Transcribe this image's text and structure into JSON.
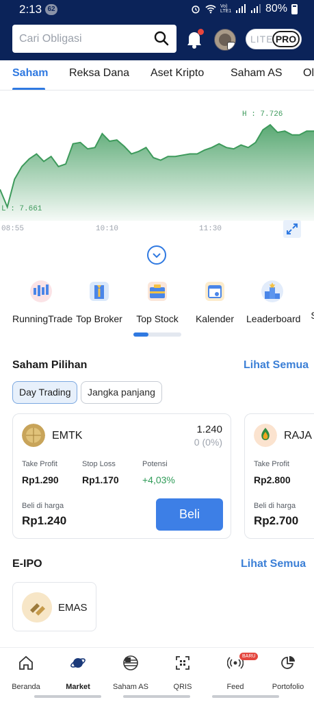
{
  "status_bar": {
    "time": "2:13",
    "notif_count": "62",
    "net_label": "Vo) LTE1",
    "battery": "80%"
  },
  "header": {
    "search_placeholder": "Cari Obligasi",
    "mode_lite": "LITE",
    "mode_pro": "PRO"
  },
  "tabs": [
    {
      "label": "Saham",
      "active": true
    },
    {
      "label": "Reksa Dana"
    },
    {
      "label": "Aset Kripto"
    },
    {
      "label": "Saham AS"
    },
    {
      "label": "Ol"
    }
  ],
  "chart_data": {
    "type": "area",
    "high_label": "H : 7.726",
    "low_label": "L : 7.661",
    "x_ticks": [
      "08:55",
      "10:10",
      "11:30"
    ],
    "color": "#3d9a5b",
    "high": 7.726,
    "low": 7.661,
    "y": [
      7.675,
      7.661,
      7.683,
      7.693,
      7.699,
      7.703,
      7.697,
      7.701,
      7.693,
      7.695,
      7.711,
      7.712,
      7.707,
      7.708,
      7.719,
      7.713,
      7.714,
      7.709,
      7.703,
      7.705,
      7.708,
      7.7,
      7.698,
      7.701,
      7.701,
      7.702,
      7.703,
      7.703,
      7.706,
      7.708,
      7.711,
      7.708,
      7.707,
      7.71,
      7.708,
      7.712,
      7.722,
      7.726,
      7.72,
      7.721,
      7.718,
      7.718,
      7.721,
      7.721
    ]
  },
  "shortcuts": [
    {
      "label": "RunningTrade",
      "icon": "running-trade-icon"
    },
    {
      "label": "Top Broker",
      "icon": "top-broker-icon"
    },
    {
      "label": "Top Stock",
      "icon": "top-stock-icon"
    },
    {
      "label": "Kalender",
      "icon": "calendar-icon"
    },
    {
      "label": "Leaderboard",
      "icon": "leaderboard-icon"
    },
    {
      "label": "S"
    }
  ],
  "saham_pilihan": {
    "title": "Saham Pilihan",
    "link": "Lihat Semua",
    "filters": [
      {
        "label": "Day Trading",
        "active": true
      },
      {
        "label": "Jangka panjang"
      }
    ],
    "cards": [
      {
        "code": "EMTK",
        "price": "1.240",
        "change": "0 (0%)",
        "take_profit_label": "Take Profit",
        "take_profit": "Rp1.290",
        "stop_loss_label": "Stop Loss",
        "stop_loss": "Rp1.170",
        "potensi_label": "Potensi",
        "potensi": "+4,03%",
        "beli_label": "Beli di harga",
        "beli_price": "Rp1.240",
        "buy_button": "Beli"
      },
      {
        "code": "RAJA",
        "take_profit_label": "Take Profit",
        "take_profit": "Rp2.800",
        "beli_label": "Beli di harga",
        "beli_price": "Rp2.700"
      }
    ]
  },
  "eipo": {
    "title": "E-IPO",
    "link": "Lihat Semua",
    "items": [
      {
        "code": "EMAS"
      }
    ]
  },
  "bottom_nav": [
    {
      "label": "Beranda",
      "icon": "home-icon"
    },
    {
      "label": "Market",
      "icon": "market-icon",
      "active": true
    },
    {
      "label": "Saham AS",
      "icon": "us-flag-icon"
    },
    {
      "label": "QRIS",
      "icon": "qris-icon"
    },
    {
      "label": "Feed",
      "icon": "feed-icon",
      "badge": "BARU"
    },
    {
      "label": "Portofolio",
      "icon": "portfolio-icon"
    }
  ]
}
